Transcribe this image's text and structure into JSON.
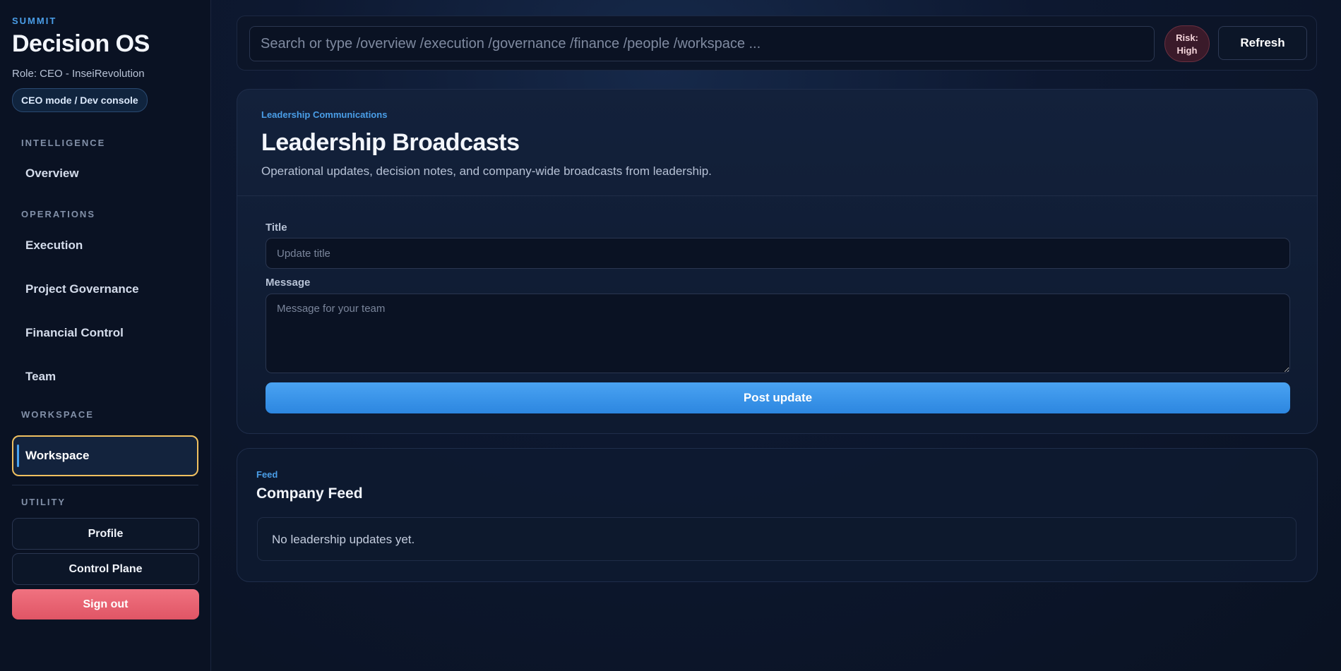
{
  "sidebar": {
    "brand_kicker": "SUMMIT",
    "brand_title": "Decision OS",
    "role": "Role: CEO - InseiRevolution",
    "mode_chip": "CEO mode / Dev console",
    "sections": {
      "intelligence": "INTELLIGENCE",
      "operations": "OPERATIONS",
      "workspace": "WORKSPACE",
      "utility": "UTILITY"
    },
    "nav": {
      "overview": "Overview",
      "execution": "Execution",
      "project_governance": "Project Governance",
      "financial_control": "Financial Control",
      "team": "Team",
      "workspace": "Workspace"
    },
    "active_item": "Workspace",
    "utility": {
      "profile": "Profile",
      "control_plane": "Control Plane",
      "sign_out": "Sign out"
    }
  },
  "topbar": {
    "search_placeholder": "Search or type /overview /execution /governance /finance /people /workspace ...",
    "risk_line1": "Risk:",
    "risk_line2": "High",
    "refresh": "Refresh"
  },
  "broadcast_card": {
    "kicker": "Leadership Communications",
    "title": "Leadership Broadcasts",
    "subtitle": "Operational updates, decision notes, and company-wide broadcasts from leadership.",
    "title_label": "Title",
    "title_placeholder": "Update title",
    "message_label": "Message",
    "message_placeholder": "Message for your team",
    "post_button": "Post update"
  },
  "feed_card": {
    "kicker": "Feed",
    "title": "Company Feed",
    "empty_text": "No leadership updates yet."
  },
  "colors": {
    "accent": "#4a9ee8",
    "active_outline": "#f0c060",
    "danger": "#e05565",
    "primary_button": "#2c86e0",
    "background": "#0a1020"
  }
}
